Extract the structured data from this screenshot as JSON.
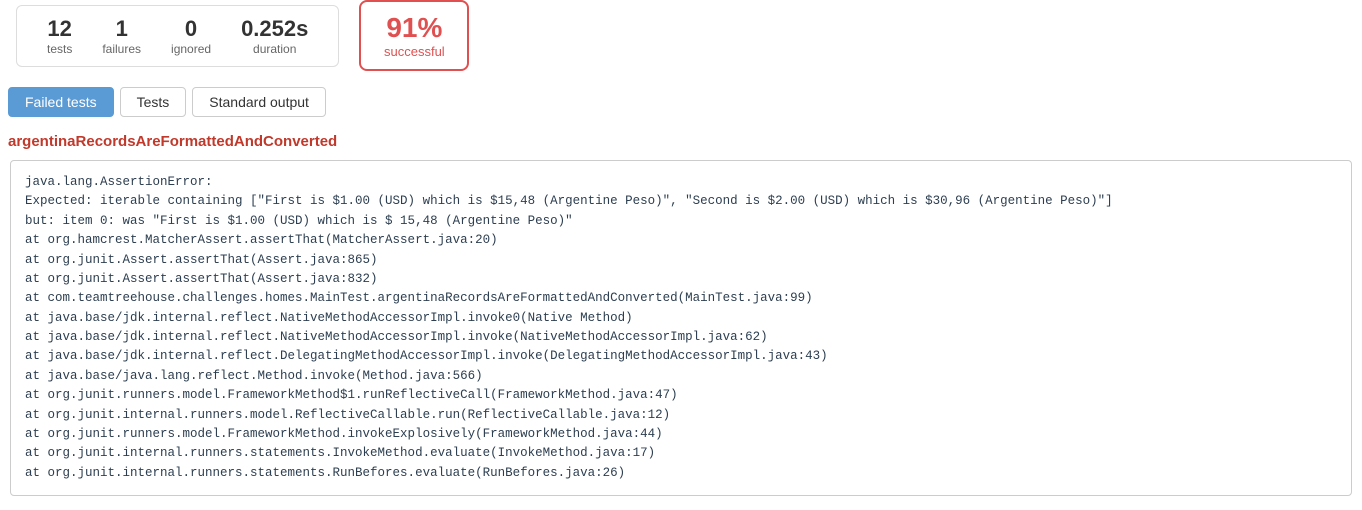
{
  "stats": {
    "tests_count": "12",
    "tests_label": "tests",
    "failures_count": "1",
    "failures_label": "failures",
    "ignored_count": "0",
    "ignored_label": "ignored",
    "duration_value": "0.252s",
    "duration_label": "duration"
  },
  "success": {
    "percent": "91%",
    "label": "successful"
  },
  "tabs": {
    "failed_tests": "Failed tests",
    "tests": "Tests",
    "standard_output": "Standard output"
  },
  "test_name": "argentinaRecordsAreFormattedAndConverted",
  "output": {
    "line1": "java.lang.AssertionError:",
    "line2": "Expected: iterable containing [\"First is $1.00 (USD) which is $15,48 (Argentine Peso)\", \"Second is $2.00 (USD) which is $30,96 (Argentine Peso)\"]",
    "line3": "     but: item 0: was \"First is $1.00 (USD) which is $ 15,48 (Argentine Peso)\"",
    "line4": "  at org.hamcrest.MatcherAssert.assertThat(MatcherAssert.java:20)",
    "line5": "  at org.junit.Assert.assertThat(Assert.java:865)",
    "line6": "  at org.junit.Assert.assertThat(Assert.java:832)",
    "line7": "  at com.teamtreehouse.challenges.homes.MainTest.argentinaRecordsAreFormattedAndConverted(MainTest.java:99)",
    "line8": "  at java.base/jdk.internal.reflect.NativeMethodAccessorImpl.invoke0(Native Method)",
    "line9": "  at java.base/jdk.internal.reflect.NativeMethodAccessorImpl.invoke(NativeMethodAccessorImpl.java:62)",
    "line10": "  at java.base/jdk.internal.reflect.DelegatingMethodAccessorImpl.invoke(DelegatingMethodAccessorImpl.java:43)",
    "line11": "  at java.base/java.lang.reflect.Method.invoke(Method.java:566)",
    "line12": "  at org.junit.runners.model.FrameworkMethod$1.runReflectiveCall(FrameworkMethod.java:47)",
    "line13": "  at org.junit.internal.runners.model.ReflectiveCallable.run(ReflectiveCallable.java:12)",
    "line14": "  at org.junit.runners.model.FrameworkMethod.invokeExplosively(FrameworkMethod.java:44)",
    "line15": "  at org.junit.internal.runners.statements.InvokeMethod.evaluate(InvokeMethod.java:17)",
    "line16": "  at org.junit.internal.runners.statements.RunBefores.evaluate(RunBefores.java:26)"
  }
}
